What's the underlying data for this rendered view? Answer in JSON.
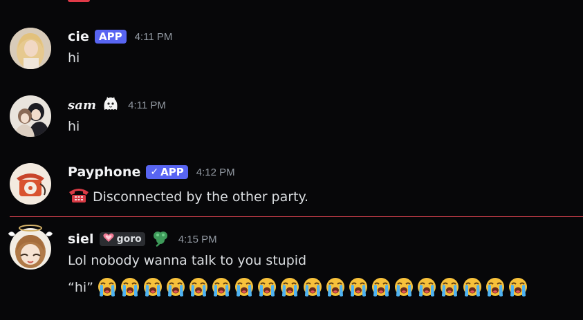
{
  "messages": [
    {
      "username": "cie",
      "tag": "APP",
      "timestamp": "4:11 PM",
      "text": "hi"
    },
    {
      "username": "sam",
      "badge_icon": "ghost-cat-emoji",
      "timestamp": "4:11 PM",
      "text": "hi"
    },
    {
      "username": "Payphone",
      "tag": "APP",
      "verified": true,
      "timestamp": "4:12 PM",
      "icon": "telephone-emoji",
      "text": "Disconnected by the other party."
    },
    {
      "username": "siel",
      "guild_tag": "goro",
      "guild_icon": "heart-icon",
      "badge_icon": "clover-icon",
      "timestamp": "4:15 PM",
      "line1": "Lol nobody wanna talk to you stupid",
      "line2_prefix": "“hi”",
      "crying_emoji_count": 19
    }
  ],
  "colors": {
    "background": "#070709",
    "app_tag": "#5865f2",
    "divider": "#d8424f",
    "timestamp": "#949ba4",
    "text": "#dbdee1"
  }
}
